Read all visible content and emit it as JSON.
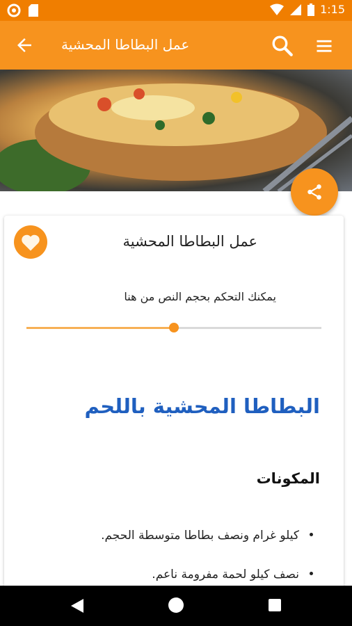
{
  "status_bar": {
    "time": "1:15"
  },
  "app_bar": {
    "title": "عمل البطاطا المحشية"
  },
  "card": {
    "title": "عمل البطاطا المحشية",
    "text_size_hint": "يمكنك التحكم بحجم النص من هنا",
    "text_size_level": 0.5
  },
  "content": {
    "recipe_title": "البطاطا المحشية باللحم",
    "ingredients_heading": "المكونات",
    "ingredients": [
      "كيلو غرام ونصف بطاطا متوسطة الحجم.",
      "نصف كيلو لحمة مفرومة ناعم."
    ]
  },
  "colors": {
    "primary": "#f7931e",
    "status": "#f07e00",
    "link_title": "#1f5fbf"
  },
  "icons": [
    "back-arrow-icon",
    "search-icon",
    "menu-icon",
    "share-icon",
    "heart-icon"
  ]
}
